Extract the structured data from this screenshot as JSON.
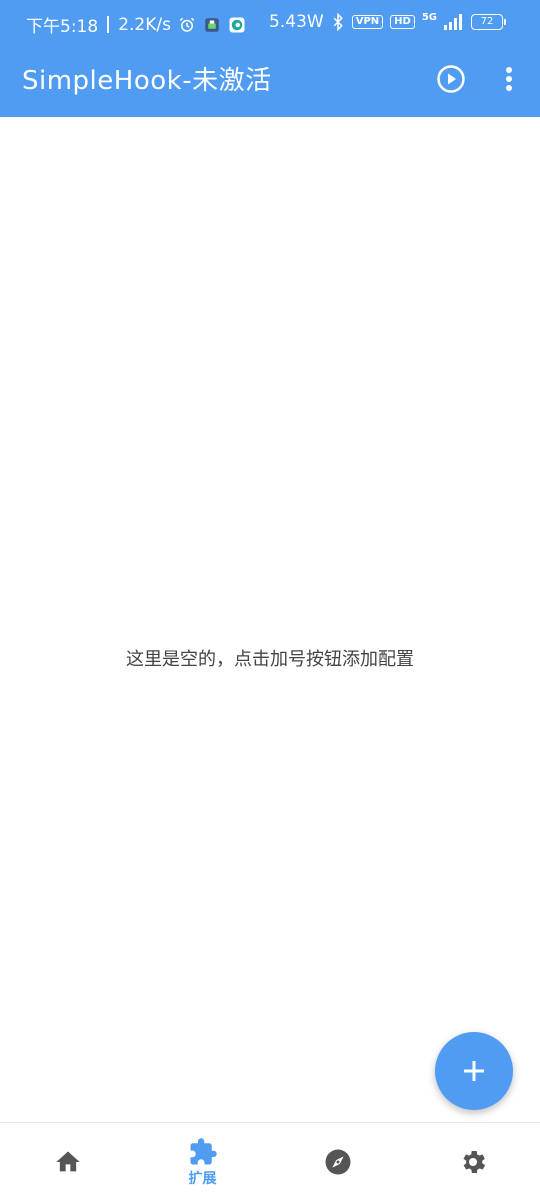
{
  "status_bar": {
    "time": "下午5:18",
    "net_speed": "2.2K/s",
    "power": "5.43W",
    "vpn_label": "VPN",
    "hd_label": "HD",
    "network_type": "5G",
    "battery_level": "72"
  },
  "toolbar": {
    "title": "SimpleHook-未激活",
    "play_icon": "play-circle-icon",
    "more_icon": "more-vert-icon"
  },
  "content": {
    "empty_message": "这里是空的，点击加号按钮添加配置"
  },
  "fab": {
    "icon": "plus-icon"
  },
  "bottom_nav": {
    "items": [
      {
        "icon": "home-icon",
        "label": "",
        "active": false
      },
      {
        "icon": "extension-icon",
        "label": "扩展",
        "active": true
      },
      {
        "icon": "compass-icon",
        "label": "",
        "active": false
      },
      {
        "icon": "settings-icon",
        "label": "",
        "active": false
      }
    ]
  },
  "colors": {
    "primary": "#4f9cf2",
    "inactive_icon": "#555555",
    "text": "#444444",
    "background": "#ffffff"
  }
}
